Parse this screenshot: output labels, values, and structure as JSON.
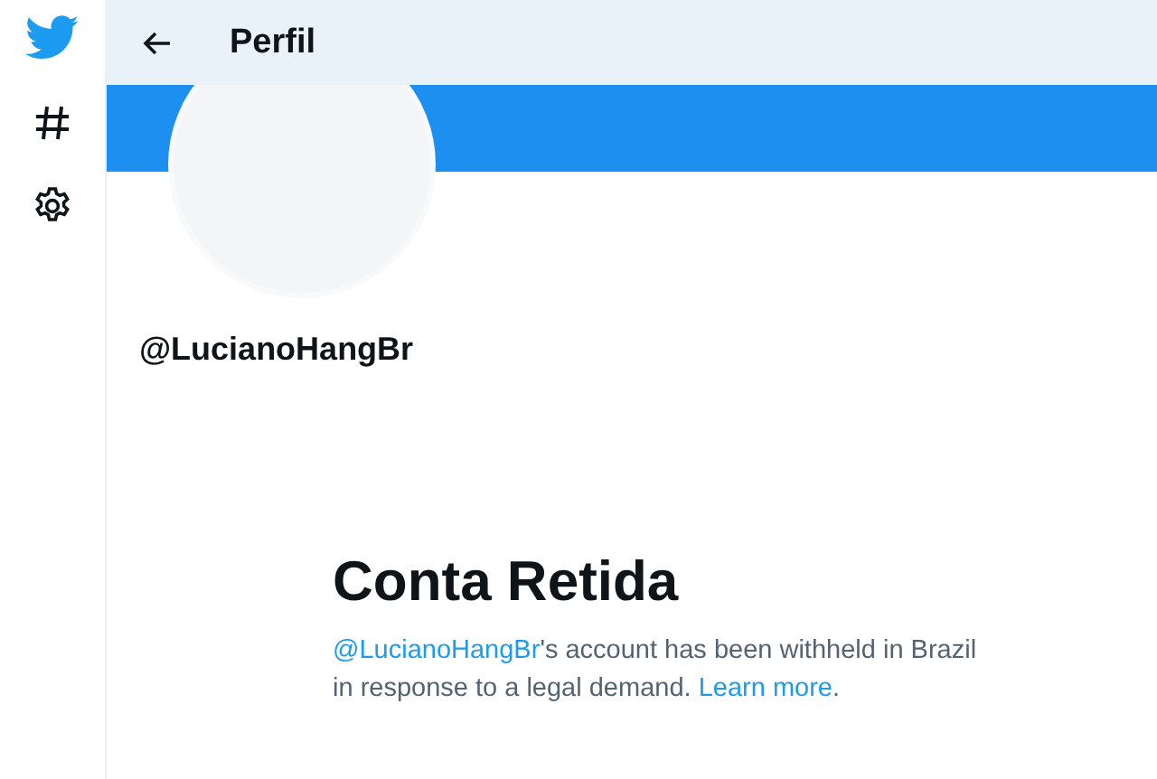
{
  "header": {
    "title": "Perfil"
  },
  "profile": {
    "handle": "@LucianoHangBr"
  },
  "notice": {
    "title": "Conta Retida",
    "parts": [
      {
        "kind": "link",
        "text": "@LucianoHangBr"
      },
      {
        "kind": "text",
        "text": "'s account has been withheld in Brazil in response to a legal demand. "
      },
      {
        "kind": "link",
        "text": "Learn more"
      },
      {
        "kind": "text",
        "text": "."
      }
    ]
  }
}
